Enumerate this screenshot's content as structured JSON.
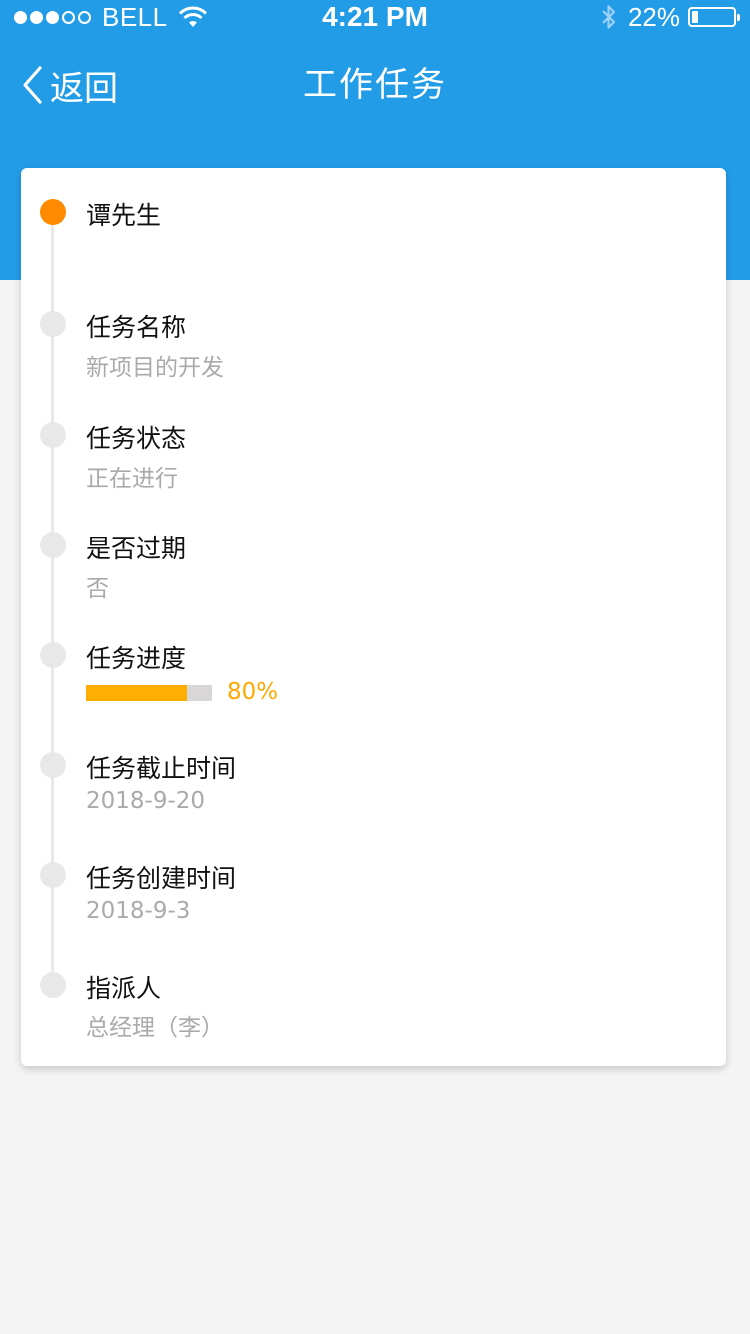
{
  "status_bar": {
    "carrier": "BELL",
    "time": "4:21 PM",
    "battery": "22%",
    "battery_level": 0.22,
    "signal_bars": 3,
    "signal_total": 5,
    "icons": [
      "signal-dots-icon",
      "wifi-icon",
      "bluetooth-icon",
      "battery-icon"
    ]
  },
  "nav": {
    "back_label": "返回",
    "title": "工作任务"
  },
  "task": {
    "person": "谭先生",
    "items": [
      {
        "label": "任务名称",
        "value": "新项目的开发"
      },
      {
        "label": "任务状态",
        "value": "正在进行"
      },
      {
        "label": "是否过期",
        "value": "否"
      },
      {
        "label": "任务进度",
        "progress": 0.8,
        "progress_text": "80%"
      },
      {
        "label": "任务截止时间",
        "value": "2018-9-20"
      },
      {
        "label": "任务创建时间",
        "value": "2018-9-3"
      },
      {
        "label": "指派人",
        "value": "总经理（李）"
      }
    ]
  },
  "colors": {
    "header": "#239ce8",
    "active_bullet": "#ff8a00",
    "inactive_bullet": "#e8e8e8",
    "progress_fill": "#ffae00",
    "progress_track": "#d8d6d6",
    "progress_text": "#ffa800",
    "background": "#f4f4f4"
  }
}
